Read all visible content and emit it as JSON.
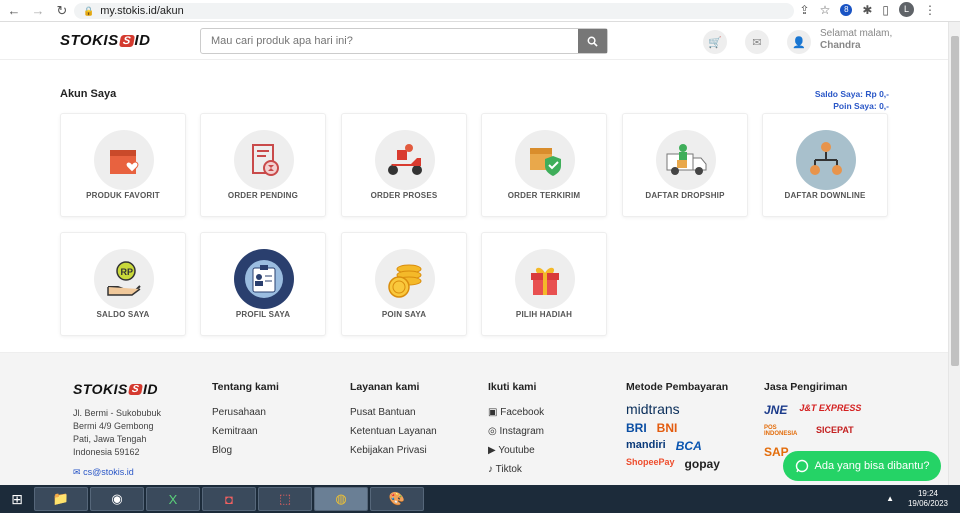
{
  "browser": {
    "url": "my.stokis.id/akun"
  },
  "header": {
    "logo_left": "STOKIS",
    "logo_right": "ID",
    "search_placeholder": "Mau cari produk apa hari ini?",
    "greeting": "Selamat malam,",
    "username": "Chandra"
  },
  "account": {
    "title": "Akun Saya",
    "saldo": "Saldo Saya: Rp 0,-",
    "poin": "Poin Saya: 0,-"
  },
  "menu": [
    {
      "label": "PRODUK FAVORIT",
      "icon": "favorite-box-icon"
    },
    {
      "label": "ORDER PENDING",
      "icon": "pending-order-icon"
    },
    {
      "label": "ORDER PROSES",
      "icon": "delivery-scooter-icon"
    },
    {
      "label": "ORDER TERKIRIM",
      "icon": "shipped-box-icon"
    },
    {
      "label": "DAFTAR DROPSHIP",
      "icon": "dropship-van-icon"
    },
    {
      "label": "DAFTAR DOWNLINE",
      "icon": "downline-network-icon"
    },
    {
      "label": "SALDO SAYA",
      "icon": "balance-hand-icon"
    },
    {
      "label": "PROFIL SAYA",
      "icon": "profile-card-icon"
    },
    {
      "label": "POIN SAYA",
      "icon": "coins-icon"
    },
    {
      "label": "PILIH HADIAH",
      "icon": "gift-icon"
    }
  ],
  "footer": {
    "address": [
      "Jl. Bermi - Sukobubuk",
      "Bermi 4/9 Gembong",
      "Pati, Jawa Tengah",
      "Indonesia 59162"
    ],
    "email": "cs@stokis.id",
    "tentang": {
      "title": "Tentang kami",
      "items": [
        "Perusahaan",
        "Kemitraan",
        "Blog"
      ]
    },
    "layanan": {
      "title": "Layanan kami",
      "items": [
        "Pusat Bantuan",
        "Ketentuan Layanan",
        "Kebijakan Privasi"
      ]
    },
    "ikuti": {
      "title": "Ikuti kami",
      "items": [
        "Facebook",
        "Instagram",
        "Youtube",
        "Tiktok"
      ]
    },
    "pembayaran": {
      "title": "Metode Pembayaran",
      "items": [
        "midtrans",
        "BRI",
        "BNI",
        "mandiri",
        "BCA",
        "ShopeePay",
        "gopay"
      ]
    },
    "pengiriman": {
      "title": "Jasa Pengiriman",
      "items": [
        "JNE",
        "J&T EXPRESS",
        "POS INDONESIA",
        "SICEPAT",
        "SAP"
      ]
    }
  },
  "whatsapp": {
    "label": "Ada yang bisa dibantu?"
  },
  "taskbar": {
    "time": "19:24",
    "date": "19/06/2023"
  },
  "colors": {
    "accent": "#d43a2f",
    "link": "#2a57c7",
    "whatsapp": "#25d366"
  }
}
